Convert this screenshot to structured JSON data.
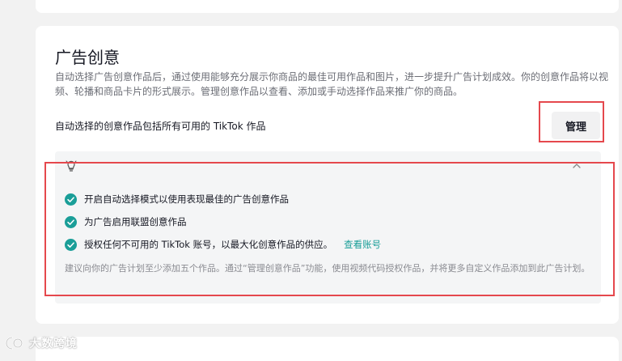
{
  "card": {
    "title": "广告创意",
    "description": "自动选择广告创意作品后，通过使用能够充分展示你商品的最佳可用作品和图片，进一步提升广告计划成效。你的创意作品将以视频、轮播和商品卡片的形式展示。管理创意作品以查看、添加或手动选择作品来推广你的商品。",
    "auto_select_text": "自动选择的创意作品包括所有可用的 TikTok 作品",
    "manage_label": "管理"
  },
  "tips": {
    "icon": "lightbulb-icon",
    "items": [
      {
        "text": "开启自动选择模式以使用表现最佳的广告创意作品"
      },
      {
        "text": "为广告启用联盟创意作品"
      },
      {
        "text": "授权任何不可用的 TikTok 账号，以最大化创意作品的供应。",
        "link": "查看账号"
      }
    ],
    "note": "建议向你的广告计划至少添加五个作品。通过“管理创意作品”功能，使用视频代码授权作品，并将更多自定义作品添加到此广告计划。"
  },
  "watermark": {
    "text": "大数跨境"
  },
  "colors": {
    "check": "#1a9e98",
    "link": "#1a9e98",
    "highlight": "#e5484d"
  }
}
